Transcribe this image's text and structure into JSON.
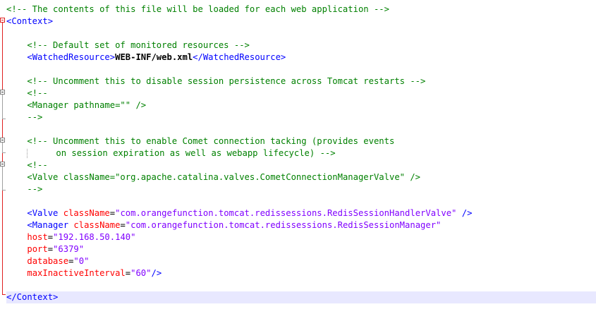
{
  "lines": {
    "l1": {
      "c1": "<!-- The contents of this file will be loaded for each web application -->"
    },
    "l2": {
      "c1": "<Context>"
    },
    "l4": {
      "c1": "<!-- Default set of monitored resources -->"
    },
    "l5": {
      "t1": "<WatchedResource>",
      "x1": "WEB-INF/web.xml",
      "t2": "</WatchedResource>"
    },
    "l7": {
      "c1": "<!-- Uncomment this to disable session persistence across Tomcat restarts -->"
    },
    "l8": {
      "c1": "<!--"
    },
    "l9": {
      "c1": "<Manager pathname=\"\" />"
    },
    "l10": {
      "c1": "-->"
    },
    "l12": {
      "c1": "<!-- Uncomment this to enable Comet connection tacking (provides events"
    },
    "l13": {
      "c1": "on session expiration as well as webapp lifecycle) -->"
    },
    "l14": {
      "c1": "<!--"
    },
    "l15": {
      "c1": "<Valve className=\"org.apache.catalina.valves.CometConnectionManagerValve\" />"
    },
    "l16": {
      "c1": "-->"
    },
    "l18": {
      "t1": "<Valve",
      "a1": "className",
      "e1": "=",
      "v1": "\"com.orangefunction.tomcat.redissessions.RedisSessionHandlerValve\"",
      "t2": "/>"
    },
    "l19": {
      "t1": "<Manager",
      "a1": "className",
      "e1": "=",
      "v1": "\"com.orangefunction.tomcat.redissessions.RedisSessionManager\""
    },
    "l20": {
      "a1": "host",
      "e1": "=",
      "v1": "\"192.168.50.140\""
    },
    "l21": {
      "a1": "port",
      "e1": "=",
      "v1": "\"6379\""
    },
    "l22": {
      "a1": "database",
      "e1": "=",
      "v1": "\"0\""
    },
    "l23": {
      "a1": "maxInactiveInterval",
      "e1": "=",
      "v1": "\"60\"",
      "t1": "/>"
    },
    "l25": {
      "t1": "</Context>"
    }
  },
  "colors": {
    "comment": "#008000",
    "tag": "#0000ff",
    "attribute": "#ff0000",
    "value": "#8000ff",
    "current_line": "#e8e8ff",
    "fold_marker": "#e02020"
  }
}
